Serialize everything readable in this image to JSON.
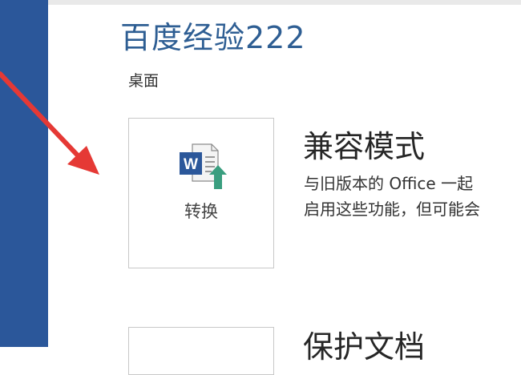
{
  "backstage": {
    "document_title": "百度经验222",
    "document_location": "桌面"
  },
  "compatibility": {
    "convert_button_label": "转换",
    "convert_icon": "word-convert-icon",
    "title": "兼容模式",
    "desc_line1": "与旧版本的 Office 一起",
    "desc_line2": "启用这些功能，但可能会"
  },
  "protect": {
    "title": "保护文档"
  },
  "annotation": {
    "arrow_color": "#e53935"
  },
  "colors": {
    "backstage_sidebar": "#2b579a",
    "title_blue": "#2e5e93",
    "word_blue": "#2b579a",
    "convert_arrow_green": "#3a9e7f"
  }
}
